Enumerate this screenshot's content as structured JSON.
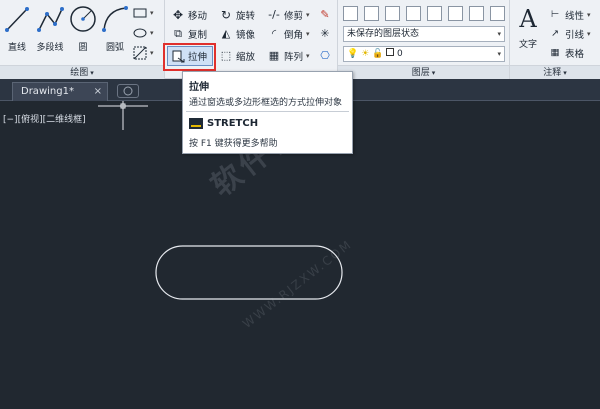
{
  "ribbon": {
    "draw_panel": {
      "title": "绘图",
      "line_label": "直线",
      "polyline_label": "多段线",
      "circle_label": "圆",
      "arc_label": "圆弧"
    },
    "modify_panel": {
      "move_label": "移动",
      "rotate_label": "旋转",
      "trim_label": "修剪",
      "copy_label": "复制",
      "mirror_label": "镜像",
      "fillet_label": "倒角",
      "stretch_label": "拉伸",
      "scale_label": "缩放",
      "array_label": "阵列"
    },
    "layers_panel": {
      "title": "图层",
      "layer_state": "未保存的图层状态",
      "current_layer": "0"
    },
    "annotation_panel": {
      "title": "注释",
      "text_label": "文字",
      "linear_label": "线性",
      "leader_label": "引线",
      "table_label": "表格"
    }
  },
  "tabs": {
    "active": "Drawing1*",
    "close": "×"
  },
  "viewport": {
    "label": "[−][俯视][二维线框]"
  },
  "tooltip": {
    "title": "拉伸",
    "description": "通过窗选或多边形框选的方式拉伸对象",
    "command": "STRETCH",
    "help": "按 F1 键获得更多帮助"
  },
  "watermark": {
    "main": "软件自学网",
    "url": "WWW.RJZXW.COM"
  },
  "colors": {
    "canvas": "#212830",
    "highlight": "#e0302d",
    "shape_stroke": "#e6e9ee"
  }
}
